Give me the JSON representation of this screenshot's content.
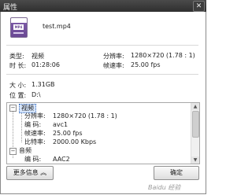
{
  "window": {
    "title": "属性"
  },
  "file": {
    "icon_text": "MP4",
    "name": "test.mp4"
  },
  "summary": {
    "type_label": "类型:",
    "type_value": "视频",
    "duration_label": "时 长:",
    "duration_value": "01:28:06",
    "resolution_label": "分辨率:",
    "resolution_value": "1280×720 (1.78 : 1)",
    "framerate_label": "帧速率:",
    "framerate_value": "25.00 fps"
  },
  "location": {
    "size_label": "大 小:",
    "size_value": "1.31GB",
    "path_label": "位 置:",
    "path_value": "D:\\"
  },
  "tree": {
    "video_label": "视频",
    "video_items": [
      {
        "label": "分辨率:",
        "value": "1280×720 (1.78 : 1)"
      },
      {
        "label": "编    码:",
        "value": "avc1"
      },
      {
        "label": "帧速率:",
        "value": "25.00 fps"
      },
      {
        "label": "比特率:",
        "value": "2000.00 Kbps"
      }
    ],
    "audio_label": "音频",
    "audio_items": [
      {
        "label": "编    码:",
        "value": "AAC2"
      }
    ]
  },
  "buttons": {
    "more_label": "更多信息",
    "more_icon": "chevrons-up",
    "ok_label": "确定"
  },
  "watermark": "Baidu 经验",
  "colors": {
    "titlebar": "#3a3a3a",
    "selection": "#d5e4fa",
    "icon_purple": "#6a4893"
  }
}
